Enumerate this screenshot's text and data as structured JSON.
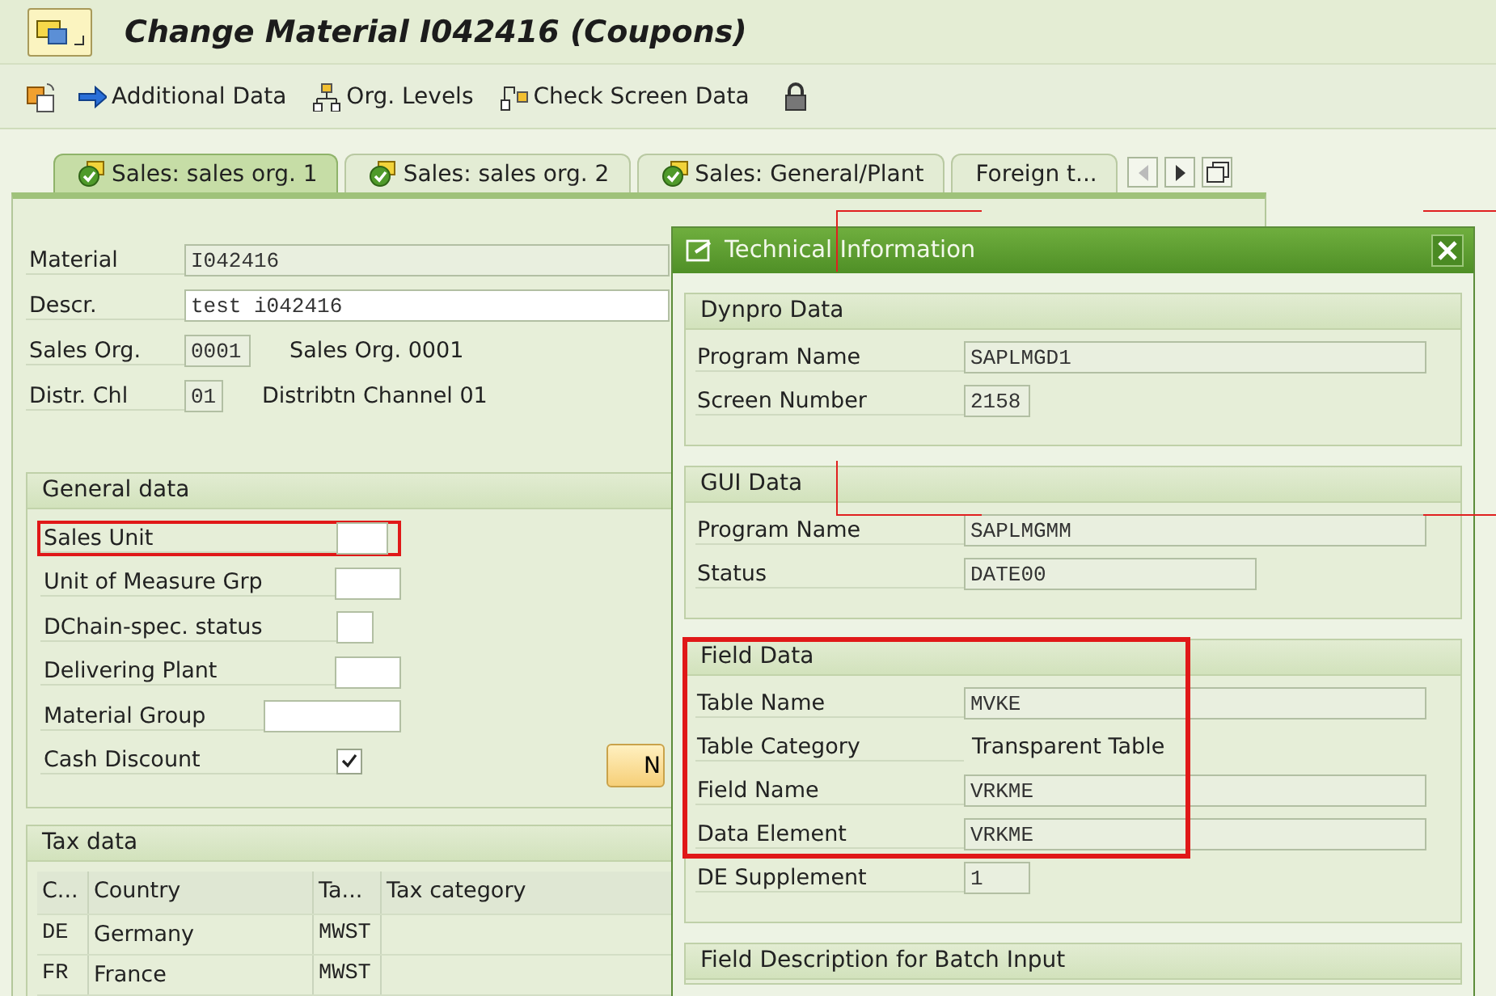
{
  "window": {
    "title": "Change Material I042416 (Coupons)"
  },
  "toolbar": [
    {
      "label": "Additional Data"
    },
    {
      "label": "Org. Levels"
    },
    {
      "label": "Check Screen Data"
    }
  ],
  "tabs": [
    {
      "label": "Sales: sales org. 1",
      "selected": true
    },
    {
      "label": "Sales: sales org. 2",
      "selected": false
    },
    {
      "label": "Sales: General/Plant",
      "selected": false
    },
    {
      "label": "Foreign t...",
      "selected": false
    }
  ],
  "header_fields": [
    {
      "label": "Material",
      "value": "I042416",
      "editable": false
    },
    {
      "label": "Descr.",
      "value": "test i042416",
      "editable": true
    },
    {
      "label": "Sales Org.",
      "value": "0001",
      "editable": false,
      "description": "Sales Org. 0001"
    },
    {
      "label": "Distr. Chl",
      "value": "01",
      "editable": false,
      "description": "Distribtn Channel 01"
    }
  ],
  "general_data": {
    "title": "General data",
    "button": "N",
    "fields": [
      {
        "label": "Sales Unit",
        "kind": "field",
        "highlighted": true
      },
      {
        "label": "Unit of Measure Grp",
        "kind": "field",
        "highlighted": false
      },
      {
        "label": "DChain-spec. status",
        "kind": "field",
        "highlighted": false
      },
      {
        "label": "Delivering Plant",
        "kind": "field",
        "highlighted": false
      },
      {
        "label": "Material Group",
        "kind": "field",
        "highlighted": false
      },
      {
        "label": "Cash Discount",
        "kind": "checkbox",
        "checked": true,
        "highlighted": false
      }
    ]
  },
  "tax_data": {
    "title": "Tax data",
    "columns": [
      "C...",
      "Country",
      "Ta...",
      "Tax category"
    ],
    "rows": [
      [
        "DE",
        "Germany",
        "MWST",
        ""
      ],
      [
        "FR",
        "France",
        "MWST",
        ""
      ]
    ]
  },
  "dialog": {
    "title": "Technical Information",
    "groups": [
      {
        "title": "Dynpro Data",
        "highlighted": false,
        "rows": [
          {
            "label": "Program Name",
            "value": "SAPLMGD1",
            "kind": "field"
          },
          {
            "label": "Screen Number",
            "value": "2158",
            "kind": "field"
          }
        ]
      },
      {
        "title": "GUI Data",
        "highlighted": false,
        "rows": [
          {
            "label": "Program Name",
            "value": "SAPLMGMM",
            "kind": "field"
          },
          {
            "label": "Status",
            "value": "DATE00",
            "kind": "field"
          }
        ]
      },
      {
        "title": "Field Data",
        "highlighted": true,
        "rows": [
          {
            "label": "Table Name",
            "value": "MVKE",
            "kind": "field"
          },
          {
            "label": "Table Category",
            "value": "Transparent Table",
            "kind": "text"
          },
          {
            "label": "Field Name",
            "value": "VRKME",
            "kind": "field"
          },
          {
            "label": "Data Element",
            "value": "VRKME",
            "kind": "field"
          }
        ],
        "after": [
          {
            "label": "DE Supplement",
            "value": "1",
            "kind": "field"
          }
        ]
      },
      {
        "title": "Field Description for Batch Input",
        "highlighted": false
      }
    ]
  }
}
